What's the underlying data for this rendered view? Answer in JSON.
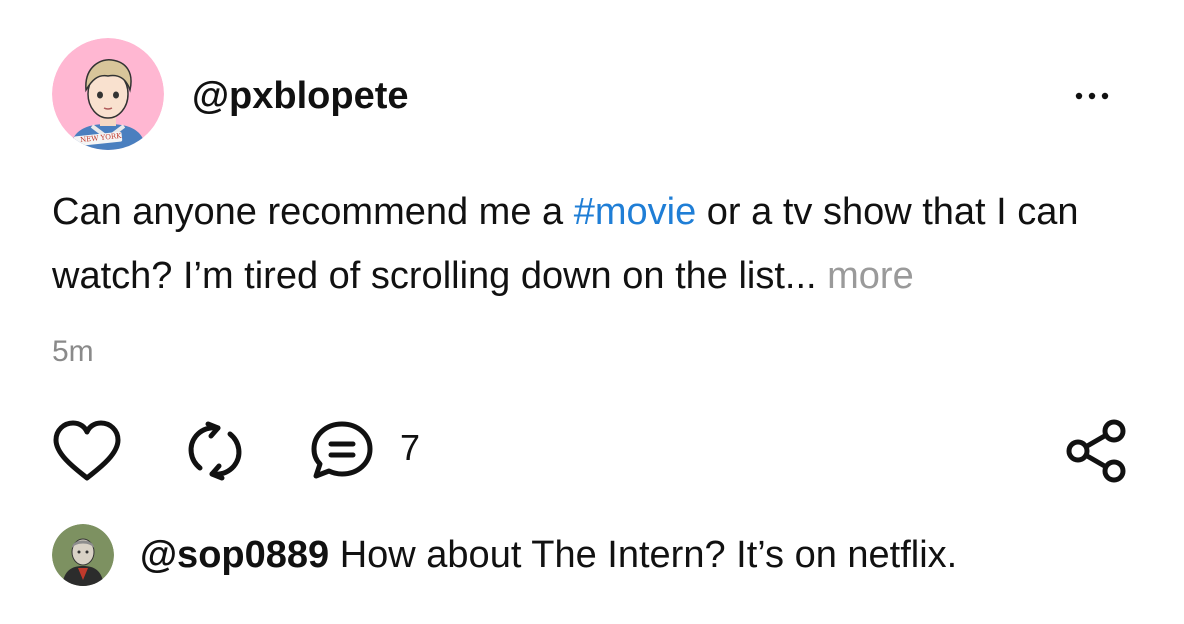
{
  "post": {
    "username": "@pxblopete",
    "avatar_badge_text": "NEW YORK",
    "text_before_hashtag": "Can anyone recommend me a ",
    "hashtag": "#movie",
    "text_after_hashtag": " or a tv show that I can watch? I’m tired of scrolling down on the list...",
    "more_label": " more",
    "timestamp": "5m",
    "accent_color": "#1f7ed6",
    "avatar_bg_color": "#ffb7d2"
  },
  "actions": {
    "like_icon": "heart-icon",
    "repost_icon": "repost-icon",
    "comment_icon": "comment-icon",
    "comment_count": "7",
    "share_icon": "share-icon",
    "menu_icon": "more-horizontal-icon"
  },
  "reply": {
    "username": "@sop0889",
    "text": " How about The Intern? It’s on netflix."
  }
}
